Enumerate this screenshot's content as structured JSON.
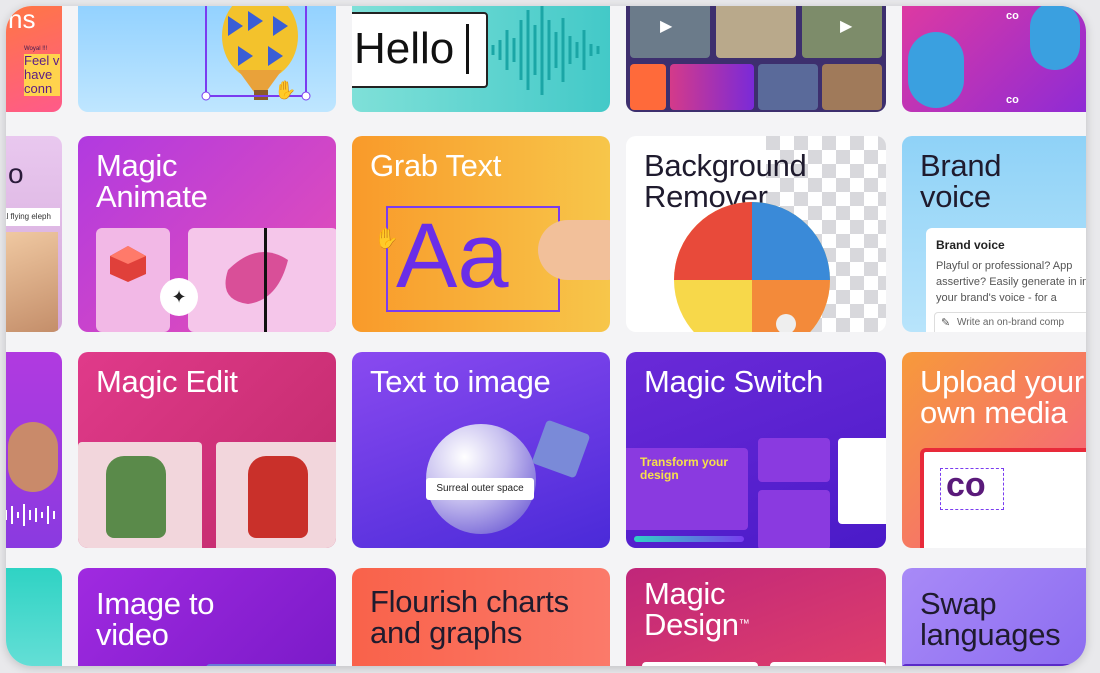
{
  "row1": {
    "left_partial_title": "ns",
    "left_partial_text": "Feel v have conn",
    "left_partial_tag": "Woyal !!!",
    "hello_text": "Hello"
  },
  "row2": {
    "left_partial_title": "o",
    "left_partial_caption": "al flying eleph",
    "magic_animate": "Magic Animate",
    "grab_text": "Grab Text",
    "grab_text_sample": "Aa",
    "background_remover": "Background Remover",
    "brand_voice": {
      "title": "Brand voice",
      "panel_heading": "Brand voice",
      "panel_body": "Playful or professional? App assertive? Easily generate in in your brand's voice - for a",
      "input_placeholder": "Write an on-brand comp"
    }
  },
  "row3": {
    "magic_edit": "Magic Edit",
    "text_to_image": "Text to image",
    "text_to_image_prompt": "Surreal outer space",
    "magic_switch": "Magic Switch",
    "magic_switch_slide_text": "Transform your design",
    "upload": "Upload your own media",
    "logo_text": "co"
  },
  "row4": {
    "image_to_video": "Image to video",
    "flourish": "Flourish charts and graphs",
    "magic_design": "Magic Design",
    "tm": "™",
    "swap_languages": "Swap languages"
  },
  "colors": {
    "purple": "#7b2ff7",
    "magenta": "#c026a8",
    "orange": "#f98a2a",
    "teal": "#2fd3c4"
  }
}
